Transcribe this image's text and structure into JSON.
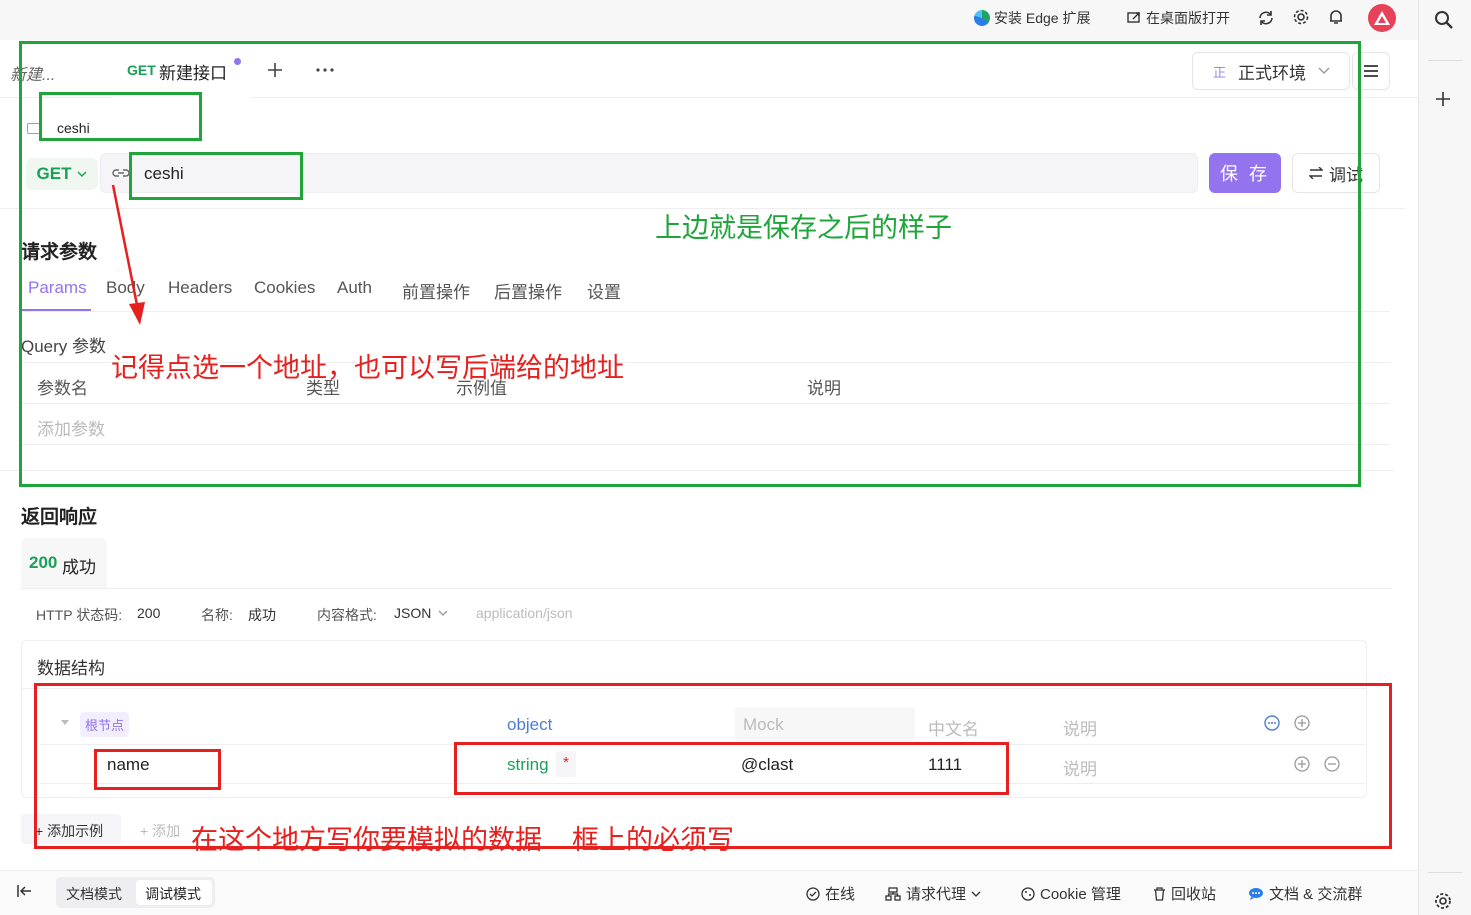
{
  "browser": {
    "install_edge": "安装 Edge 扩展",
    "open_desktop": "在桌面版打开"
  },
  "tabs": [
    {
      "label": "新建..."
    },
    {
      "method": "GET",
      "label": "新建接口"
    }
  ],
  "environment": {
    "badge": "正",
    "label": "正式环境"
  },
  "api": {
    "name": "ceshi",
    "method": "GET",
    "path": "ceshi",
    "save_label": "保 存",
    "debug_label": "调试"
  },
  "request": {
    "title": "请求参数",
    "tabs": [
      "Params",
      "Body",
      "Headers",
      "Cookies",
      "Auth",
      "前置操作",
      "后置操作",
      "设置"
    ],
    "query_label": "Query 参数",
    "columns": [
      "参数名",
      "类型",
      "示例值",
      "说明"
    ],
    "add_param": "添加参数"
  },
  "response": {
    "title": "返回响应",
    "status_tab": {
      "code": "200",
      "label": "成功"
    },
    "meta": {
      "status_label": "HTTP 状态码:",
      "status_value": "200",
      "name_label": "名称:",
      "name_value": "成功",
      "format_label": "内容格式:",
      "format_value": "JSON",
      "content_type": "application/json"
    },
    "structure_title": "数据结构",
    "root": {
      "label": "根节点",
      "type": "object",
      "mock": "Mock",
      "cn_name": "中文名",
      "desc": "说明"
    },
    "fields": [
      {
        "name": "name",
        "type": "string",
        "required": "*",
        "mock": "@clast",
        "cn_name": "1111",
        "desc": "说明"
      }
    ],
    "add_example": "添加示例",
    "add_other": "添加"
  },
  "annotations": {
    "saved": "上边就是保存之后的样子",
    "pick_address": "记得点选一个地址，也可以写后端给的地址",
    "mock_hint": "在这个地方写你要模拟的数据    框上的必须写"
  },
  "bottom": {
    "doc_mode": "文档模式",
    "debug_mode": "调试模式",
    "online": "在线",
    "proxy": "请求代理",
    "cookie": "Cookie 管理",
    "trash": "回收站",
    "docs": "文档 & 交流群"
  },
  "colors": {
    "accent": "#9373ee",
    "get_green": "#18a058",
    "annot_green": "#1fa53a",
    "annot_red": "#e6201e"
  }
}
